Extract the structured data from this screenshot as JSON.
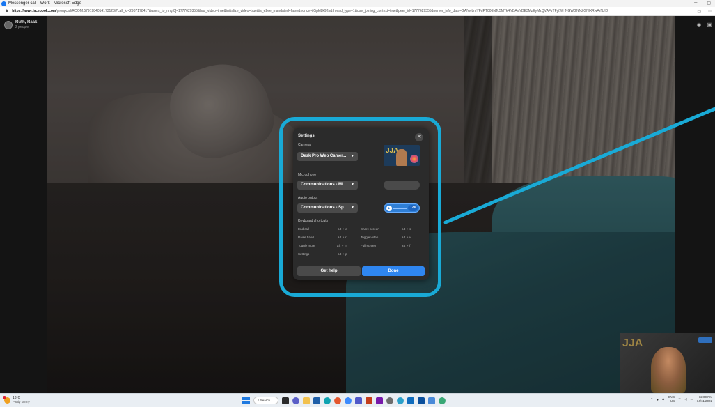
{
  "window": {
    "title": "Messenger call - Work - Microsoft Edge",
    "url_host": "https://www.facebook.com",
    "url_rest": "/groupcall/ROOM:5791984014173123/?call_id=2967178417&users_to_ring[0]=1777629355&has_video=true&initialize_video=true&is_e2ee_mandated=false&nonce=il0ipkl8k92n&thread_type=1&use_joining_context=true&peer_id=1777629355&server_info_data=GANwbmYFdPT006NTc5MTk4NDAxNDE3MzEyMzQVAFvTFytWHNGWGNNZGNlXRwArNJlD"
  },
  "call": {
    "participant_name": "Ruth, Raak",
    "participant_count": "2 people"
  },
  "settings": {
    "title": "Settings",
    "camera_label": "Camera",
    "camera_value": "Desk Pro Web Camer...",
    "microphone_label": "Microphone",
    "microphone_value": "Communications - Mi...",
    "audio_output_label": "Audio output",
    "audio_output_value": "Communications - Sp...",
    "audio_test_duration": "12s",
    "shortcuts_label": "Keyboard shortcuts",
    "shortcuts": [
      {
        "name": "End call",
        "keys": "alt  +  e"
      },
      {
        "name": "Raise hand",
        "keys": "alt  +  r"
      },
      {
        "name": "Toggle mute",
        "keys": "alt  +  m"
      },
      {
        "name": "Settings",
        "keys": "alt  +  p"
      },
      {
        "name": "Share screen",
        "keys": "alt  +  s"
      },
      {
        "name": "Toggle video",
        "keys": "alt  +  v"
      },
      {
        "name": "Full screen",
        "keys": "alt  +  f"
      }
    ],
    "help_button": "Get help",
    "done_button": "Done"
  },
  "taskbar": {
    "weather_temp": "16°C",
    "weather_desc": "Partly sunny",
    "search_label": "Search",
    "lang": "ENG",
    "region": "US",
    "time": "12:00 PM",
    "date": "14/11/2022"
  },
  "colors": {
    "highlight_ring": "#19aad6",
    "done_button": "#2f86f0",
    "dialog_bg": "#2b2b2b"
  }
}
